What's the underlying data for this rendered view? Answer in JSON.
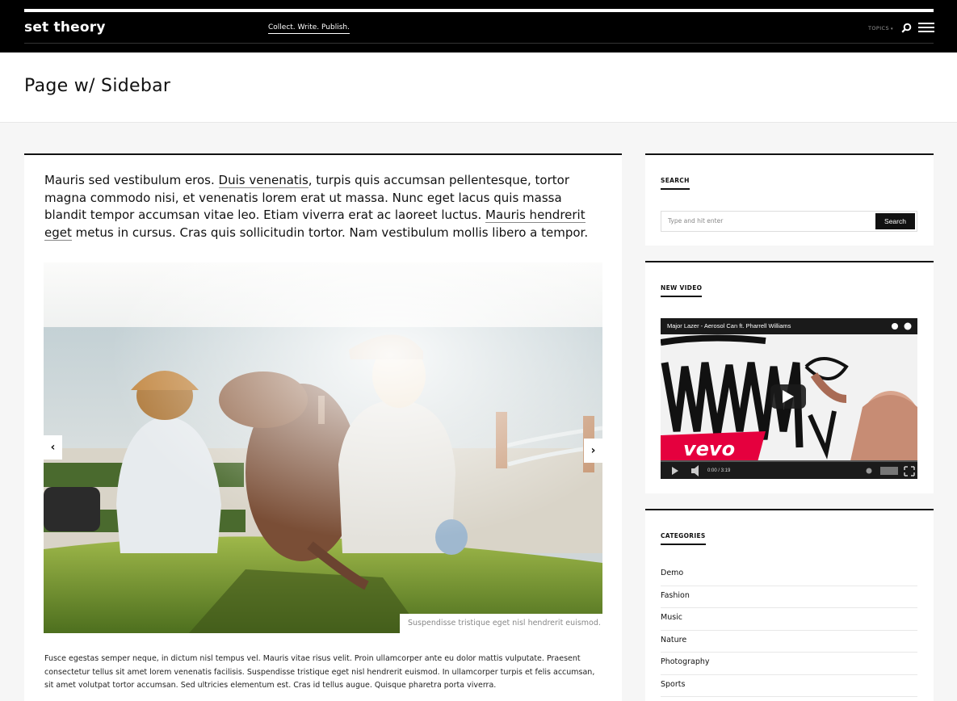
{
  "header": {
    "logo": "set theory",
    "tagline": "Collect. Write. Publish.",
    "topics_label": "TOPICS",
    "icons": [
      "search-icon",
      "hamburger-menu-icon"
    ]
  },
  "page": {
    "title": "Page w/ Sidebar"
  },
  "main": {
    "intro": {
      "p1": "Mauris sed vestibulum eros. ",
      "link1": "Duis venenatis",
      "p2": ", turpis quis accumsan pellentesque, tortor magna commodo nisi, et venenatis lorem erat ut massa. Nunc eget lacus quis massa blandit tempor accumsan vitae leo. Etiam viverra erat ac laoreet luctus. ",
      "link2": "Mauris hendrerit eget",
      "p3": " metus in cursus. Cras quis sollicitudin tortor. Nam vestibulum mollis libero a tempor."
    },
    "slider": {
      "caption": "Suspendisse tristique eget nisl hendrerit euismod.",
      "prev_icon": "chevron-left-icon",
      "next_icon": "chevron-right-icon"
    },
    "body_text": "Fusce egestas semper neque, in dictum nisl tempus vel. Mauris vitae risus velit. Proin ullamcorper ante eu dolor mattis vulputate. Praesent consectetur tellus sit amet lorem venenatis facilisis. Suspendisse tristique eget nisl hendrerit euismod. In ullamcorper turpis et felis accumsan, sit amet volutpat tortor accumsan. Sed ultricies elementum est. Cras id tellus augue. Quisque pharetra porta viverra."
  },
  "sidebar": {
    "search": {
      "title": "SEARCH",
      "placeholder": "Type and hit enter",
      "button": "Search"
    },
    "video": {
      "title": "NEW VIDEO",
      "video_title": "Major Lazer - Aerosol Can ft. Pharrell Williams",
      "time": "0:00 / 3:19",
      "brand": "vevo"
    },
    "categories": {
      "title": "CATEGORIES",
      "items": [
        "Demo",
        "Fashion",
        "Music",
        "Nature",
        "Photography",
        "Sports"
      ]
    }
  }
}
